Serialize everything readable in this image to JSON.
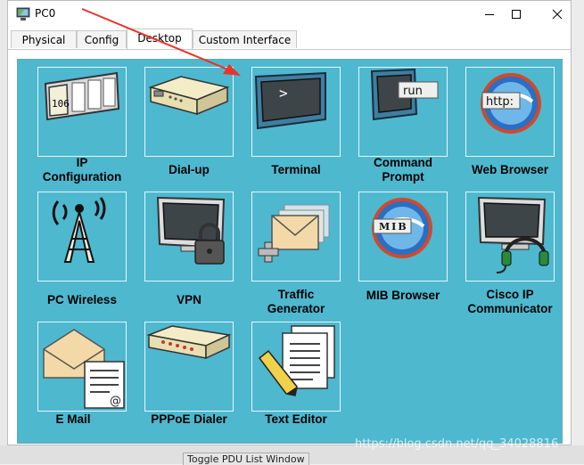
{
  "window": {
    "title": "PC0",
    "controls": {
      "minimize": "minimize",
      "maximize": "maximize",
      "close": "close"
    }
  },
  "tabs": [
    {
      "label": "Physical",
      "active": false
    },
    {
      "label": "Config",
      "active": false
    },
    {
      "label": "Desktop",
      "active": true
    },
    {
      "label": "Custom Interface",
      "active": false
    }
  ],
  "apps": [
    {
      "label": "IP\nConfiguration",
      "icon": "ip-config-icon"
    },
    {
      "label": "Dial-up",
      "icon": "modem-icon"
    },
    {
      "label": "Terminal",
      "icon": "terminal-icon",
      "terminal_prompt": ">"
    },
    {
      "label": "Command\nPrompt",
      "icon": "command-prompt-icon",
      "terminal_prompt": "run"
    },
    {
      "label": "Web Browser",
      "icon": "web-browser-icon",
      "badge": "http:"
    },
    {
      "label": "PC Wireless",
      "icon": "wireless-tower-icon"
    },
    {
      "label": "VPN",
      "icon": "vpn-lock-icon"
    },
    {
      "label": "Traffic\nGenerator",
      "icon": "traffic-generator-icon"
    },
    {
      "label": "MIB Browser",
      "icon": "mib-browser-icon",
      "badge": "MIB"
    },
    {
      "label": "Cisco IP\nCommunicator",
      "icon": "ip-communicator-icon"
    },
    {
      "label": "E Mail",
      "icon": "email-icon",
      "badge": "@"
    },
    {
      "label": "PPPoE Dialer",
      "icon": "pppoe-icon"
    },
    {
      "label": "Text Editor",
      "icon": "text-editor-icon"
    }
  ],
  "ip_config_display": "106",
  "background": {
    "taskbar_fragment": "Toggle PDU List Window",
    "watermark": "https://blog.csdn.net/qq_34028816"
  },
  "colors": {
    "panel": "#4eb8cf",
    "tile_border": "#e6f6fa",
    "annotation_arrow": "#e8342a"
  }
}
